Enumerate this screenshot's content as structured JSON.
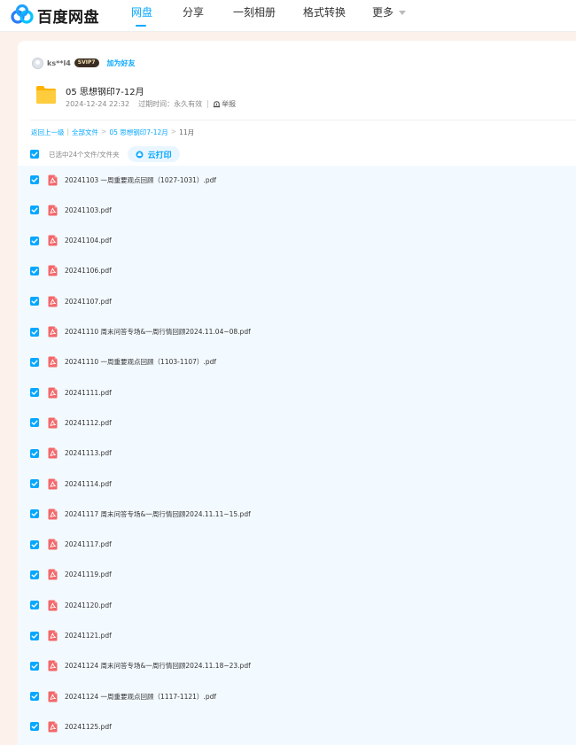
{
  "brand": {
    "name": "百度网盘"
  },
  "nav": [
    {
      "label": "网盘",
      "active": true
    },
    {
      "label": "分享",
      "active": false
    },
    {
      "label": "一刻相册",
      "active": false
    },
    {
      "label": "格式转换",
      "active": false
    },
    {
      "label": "更多",
      "active": false,
      "dropdown": true
    }
  ],
  "share": {
    "user_name": "ks**l4",
    "badge": "SVIP7",
    "add_friend_label": "加为好友",
    "folder_title": "05 思想钢印7-12月",
    "date": "2024-12-24 22:32",
    "expire_text": "过期时间：永久有效",
    "report_label": "举报"
  },
  "breadcrumb": {
    "back": "返回上一级",
    "sep": "|",
    "root": "全部文件",
    "arrow": ">",
    "parent": "05 思想钢印7-12月",
    "current": "11月"
  },
  "selection": {
    "count_text": "已选中24个文件/文件夹",
    "print_label": "云打印"
  },
  "files": [
    {
      "name": "20241103 一周重要观点回顾（1027-1031）.pdf",
      "checked": true
    },
    {
      "name": "20241103.pdf",
      "checked": true
    },
    {
      "name": "20241104.pdf",
      "checked": true
    },
    {
      "name": "20241106.pdf",
      "checked": true
    },
    {
      "name": "20241107.pdf",
      "checked": true
    },
    {
      "name": "20241110 周末问答专场&一周行情回顾2024.11.04~08.pdf",
      "checked": true
    },
    {
      "name": "20241110 一周重要观点回顾（1103-1107）.pdf",
      "checked": true
    },
    {
      "name": "20241111.pdf",
      "checked": true
    },
    {
      "name": "20241112.pdf",
      "checked": true
    },
    {
      "name": "20241113.pdf",
      "checked": true
    },
    {
      "name": "20241114.pdf",
      "checked": true
    },
    {
      "name": "20241117 周末问答专场&一周行情回顾2024.11.11~15.pdf",
      "checked": true
    },
    {
      "name": "20241117.pdf",
      "checked": true
    },
    {
      "name": "20241119.pdf",
      "checked": true
    },
    {
      "name": "20241120.pdf",
      "checked": true
    },
    {
      "name": "20241121.pdf",
      "checked": true
    },
    {
      "name": "20241124 周末问答专场&一周行情回顾2024.11.18~23.pdf",
      "checked": true
    },
    {
      "name": "20241124 一周重要观点回顾（1117-1121）.pdf",
      "checked": true
    },
    {
      "name": "20241125.pdf",
      "checked": true
    }
  ],
  "colors": {
    "accent": "#06a7ff",
    "pdf_red": "#f2686b",
    "folder": "#ffc935",
    "page_bg": "#fdf1ec"
  },
  "icons": {
    "logo": "baidu-netdisk-logo-icon",
    "folder": "folder-icon",
    "pdf": "pdf-file-icon",
    "check": "checkbox-checked-icon",
    "print": "cloud-print-icon",
    "report": "report-icon"
  }
}
